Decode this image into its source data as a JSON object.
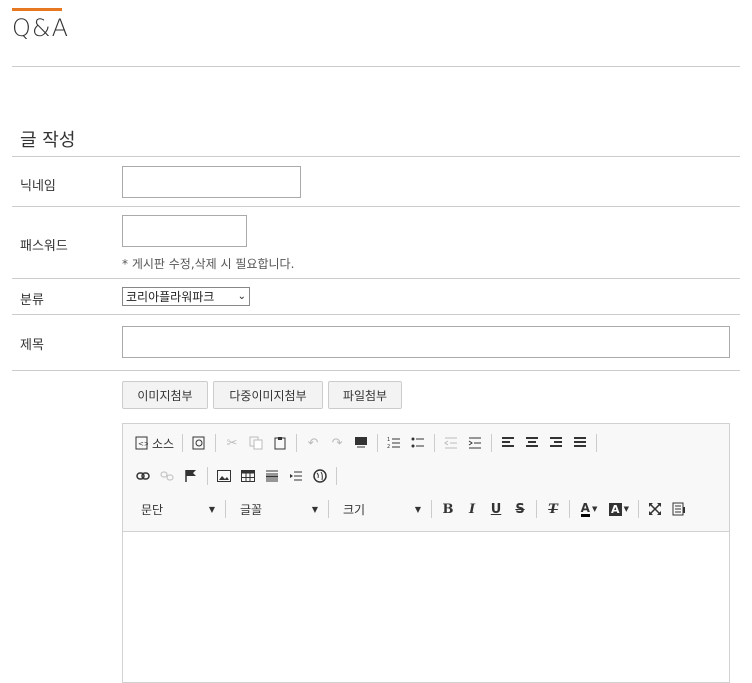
{
  "page": {
    "title": "Q&A",
    "section_title": "글 작성"
  },
  "form": {
    "nickname_label": "닉네임",
    "nickname_value": "",
    "password_label": "패스워드",
    "password_value": "",
    "password_hint": "* 게시판 수정,삭제 시 필요합니다.",
    "category_label": "분류",
    "category_selected": "코리아플라워파크",
    "subject_label": "제목",
    "subject_value": ""
  },
  "attach": {
    "image_label": "이미지첨부",
    "multi_image_label": "다중이미지첨부",
    "file_label": "파일첨부"
  },
  "editor": {
    "source_label": "소스",
    "format_label": "문단",
    "font_label": "글꼴",
    "size_label": "크기",
    "glyphs": {
      "bold": "B",
      "italic": "I",
      "underline": "U",
      "strike": "S",
      "clear": "T",
      "fontcolor": "A",
      "bgcolor": "A"
    }
  },
  "colors": {
    "accent": "#e87722"
  }
}
